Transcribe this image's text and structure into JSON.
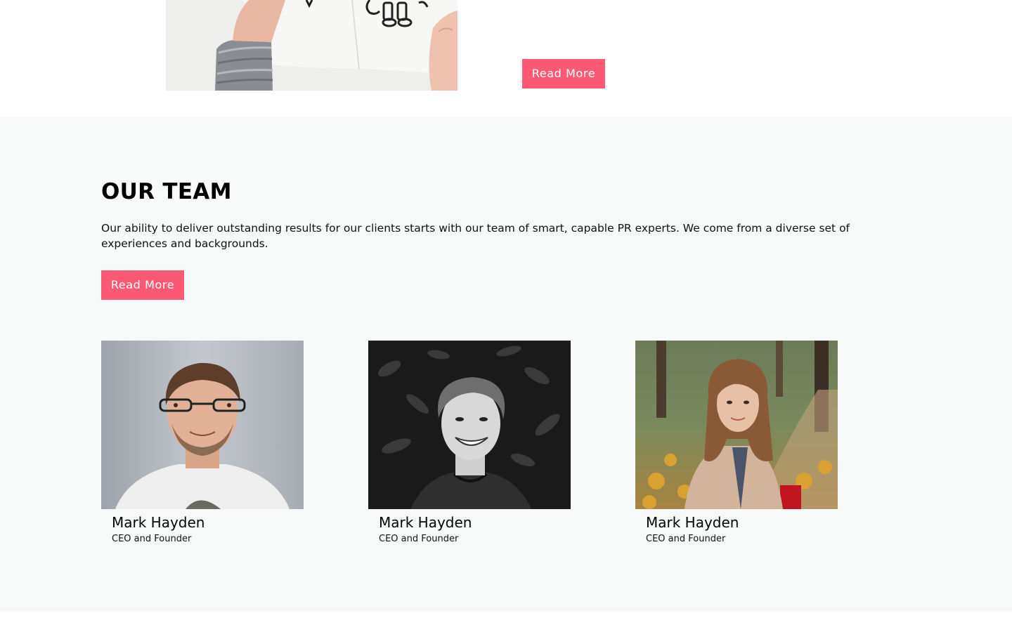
{
  "top": {
    "read_more_label": "Read More"
  },
  "team": {
    "title": "OUR TEAM",
    "description": "Our ability to deliver outstanding results for our clients starts with our team of smart, capable PR experts. We come from a diverse set of experiences and backgrounds.",
    "read_more_label": "Read More",
    "members": [
      {
        "name": "Mark Hayden",
        "role": "CEO and Founder"
      },
      {
        "name": "Mark Hayden",
        "role": "CEO and Founder"
      },
      {
        "name": "Mark Hayden",
        "role": "CEO and Founder"
      }
    ]
  },
  "colors": {
    "accent": "#fc5a74",
    "section_bg": "#f7f9f8"
  }
}
